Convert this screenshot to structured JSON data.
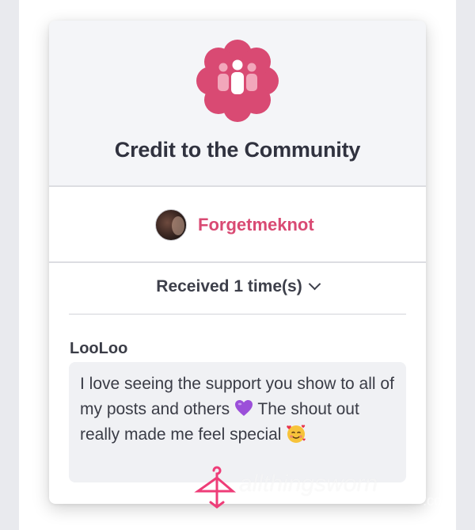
{
  "card": {
    "title": "Credit to the Community",
    "badge_icon": "community-people-icon",
    "badge_color": "#d94a73"
  },
  "recipient": {
    "name": "Forgetmeknot",
    "name_color": "#d94a73"
  },
  "received": {
    "label": "Received 1 time(s)"
  },
  "comment": {
    "sender": "LooLoo",
    "text_before_heart": "I love seeing the support you show to all of my posts and others ",
    "text_after_heart": " The shout out really made me feel special ",
    "heart_emoji": "purple-heart-icon",
    "face_emoji": "smiling-face-with-hearts-icon"
  },
  "watermark": {
    "icon": "hanger-icon",
    "text": "allthingsworn",
    "suffix": ".com"
  }
}
